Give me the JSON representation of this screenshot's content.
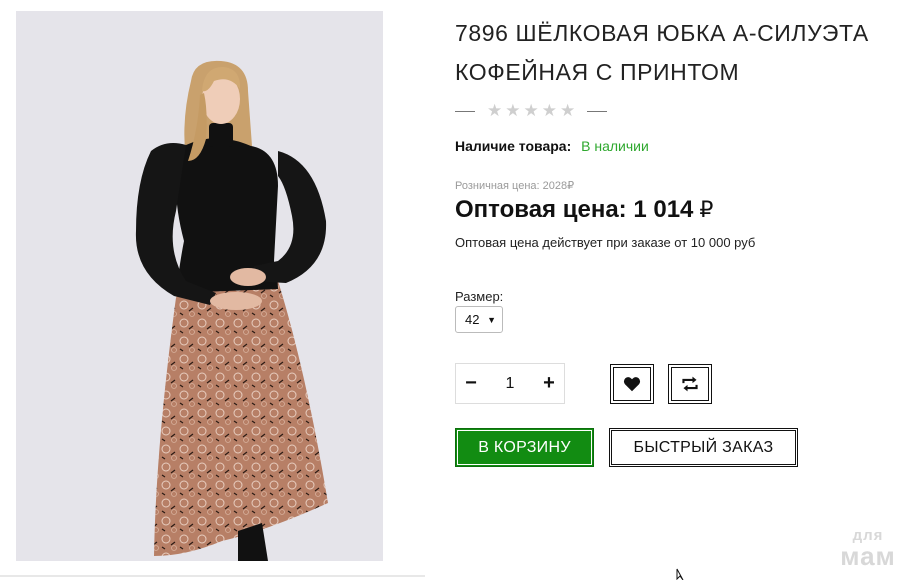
{
  "product": {
    "title": "7896 ШЁЛКОВАЯ ЮБКА А-СИЛУЭТА КОФЕЙНАЯ С ПРИНТОМ",
    "rating": {
      "stars_filled": 0,
      "stars_total": 5
    },
    "availability_label": "Наличие товара:",
    "availability_value": "В наличии",
    "retail_price_text": "Розничная цена: 2028₽",
    "wholesale_price_text": "Оптовая цена: 1 014",
    "currency_symbol": "₽",
    "wholesale_note": "Оптовая цена действует при заказе от 10 000 руб",
    "size_label": "Размер:",
    "size_selected": "42"
  },
  "quantity": {
    "minus_label": "−",
    "value": "1",
    "plus_label": "+"
  },
  "actions": {
    "add_to_cart_label": "В КОРЗИНУ",
    "quick_order_label": "БЫСТРЫЙ ЗАКАЗ",
    "wishlist_icon": "heart-icon",
    "compare_icon": "compare-arrows-icon"
  },
  "watermark": {
    "line1": "для",
    "line2": "мам"
  },
  "colors": {
    "accent_green": "#128c12",
    "availability_green": "#2ea82e",
    "photo_background": "#e5e4ea",
    "skirt": "#b77f66",
    "top": "#111111"
  }
}
